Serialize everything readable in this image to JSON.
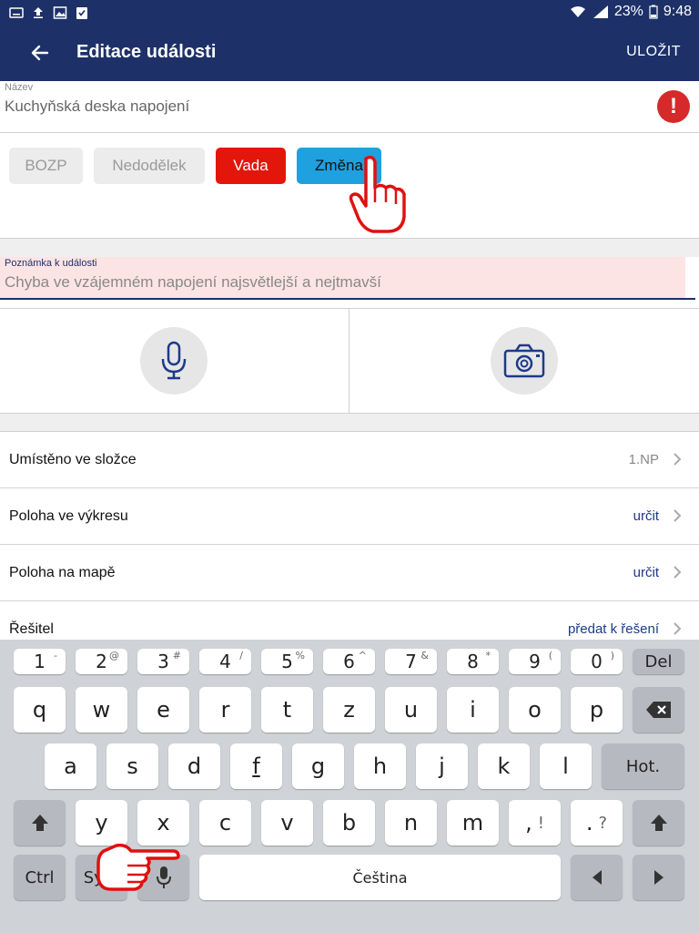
{
  "status_bar": {
    "battery": "23%",
    "time": "9:48",
    "icons": [
      "keyboard-icon",
      "upload-icon",
      "image-icon",
      "clipboard-check-icon",
      "wifi-icon",
      "signal-icon",
      "battery-icon"
    ]
  },
  "appbar": {
    "title": "Editace události",
    "save_label": "ULOŽIT"
  },
  "name_field": {
    "label": "Název",
    "value": "Kuchyňská deska napojení"
  },
  "categories": [
    {
      "label": "BOZP",
      "selected": false
    },
    {
      "label": "Nedodělek",
      "selected": false
    },
    {
      "label": "Vada",
      "selected": false,
      "color": "#e3160b"
    },
    {
      "label": "Změna",
      "selected": true,
      "color": "#1fa0df"
    }
  ],
  "note_field": {
    "label": "Poznámka k události",
    "value": "Chyba ve vzájemném napojení najsvětlejší a nejtmavší"
  },
  "rows": [
    {
      "label": "Umístěno ve složce",
      "value": "1.NP"
    },
    {
      "label": "Poloha ve výkresu",
      "value": "určit"
    },
    {
      "label": "Poloha na mapě",
      "value": "určit"
    },
    {
      "label": "Řešitel",
      "value": "předat k řešení"
    }
  ],
  "keyboard": {
    "numbers": [
      {
        "key": "1",
        "sup": "-"
      },
      {
        "key": "2",
        "sup": "@"
      },
      {
        "key": "3",
        "sup": "#"
      },
      {
        "key": "4",
        "sup": "/"
      },
      {
        "key": "5",
        "sup": "%"
      },
      {
        "key": "6",
        "sup": "^"
      },
      {
        "key": "7",
        "sup": "&"
      },
      {
        "key": "8",
        "sup": "*"
      },
      {
        "key": "9",
        "sup": "("
      },
      {
        "key": "0",
        "sup": ")"
      }
    ],
    "del": "Del",
    "row1": [
      "q",
      "w",
      "e",
      "r",
      "t",
      "z",
      "u",
      "i",
      "o",
      "p"
    ],
    "row2": [
      "a",
      "s",
      "d",
      "f",
      "g",
      "h",
      "j",
      "k",
      "l"
    ],
    "enter": "Hot.",
    "row3": [
      "y",
      "x",
      "c",
      "v",
      "b",
      "n",
      "m"
    ],
    "comma": ",",
    "comma_alt": "!",
    "period": ".",
    "period_alt": "?",
    "ctrl": "Ctrl",
    "sym": "Sym",
    "space": "Čeština"
  },
  "colors": {
    "header": "#1d3168",
    "accent_link": "#1d3a8a",
    "error": "#d62929",
    "note_bg": "#fde4e4"
  }
}
